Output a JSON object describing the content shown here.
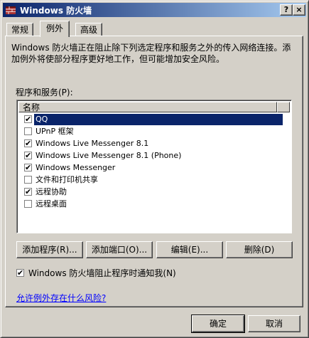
{
  "window": {
    "title": "Windows 防火墙",
    "help_label": "?",
    "close_label": "×"
  },
  "tabs": [
    {
      "label": "常规"
    },
    {
      "label": "例外"
    },
    {
      "label": "高级"
    }
  ],
  "description": "Windows 防火墙正在阻止除下列选定程序和服务之外的传入网络连接。添加例外将使部分程序更好地工作，但可能增加安全风险。",
  "programs_label": "程序和服务(P):",
  "list": {
    "header": "名称",
    "items": [
      {
        "label": "QQ",
        "checked": true,
        "selected": true
      },
      {
        "label": "UPnP 框架",
        "checked": false
      },
      {
        "label": "Windows Live Messenger 8.1",
        "checked": true
      },
      {
        "label": "Windows Live Messenger 8.1 (Phone)",
        "checked": true
      },
      {
        "label": "Windows Messenger",
        "checked": true
      },
      {
        "label": "文件和打印机共享",
        "checked": false
      },
      {
        "label": "远程协助",
        "checked": true
      },
      {
        "label": "远程桌面",
        "checked": false
      }
    ]
  },
  "buttons": {
    "add_program": "添加程序(R)...",
    "add_port": "添加端口(O)...",
    "edit": "编辑(E)...",
    "delete": "删除(D)"
  },
  "notify": {
    "label": "Windows 防火墙阻止程序时通知我(N)",
    "checked": true
  },
  "risk_link": "允许例外存在什么风险?",
  "footer": {
    "ok": "确定",
    "cancel": "取消"
  },
  "check_mark": "✔"
}
